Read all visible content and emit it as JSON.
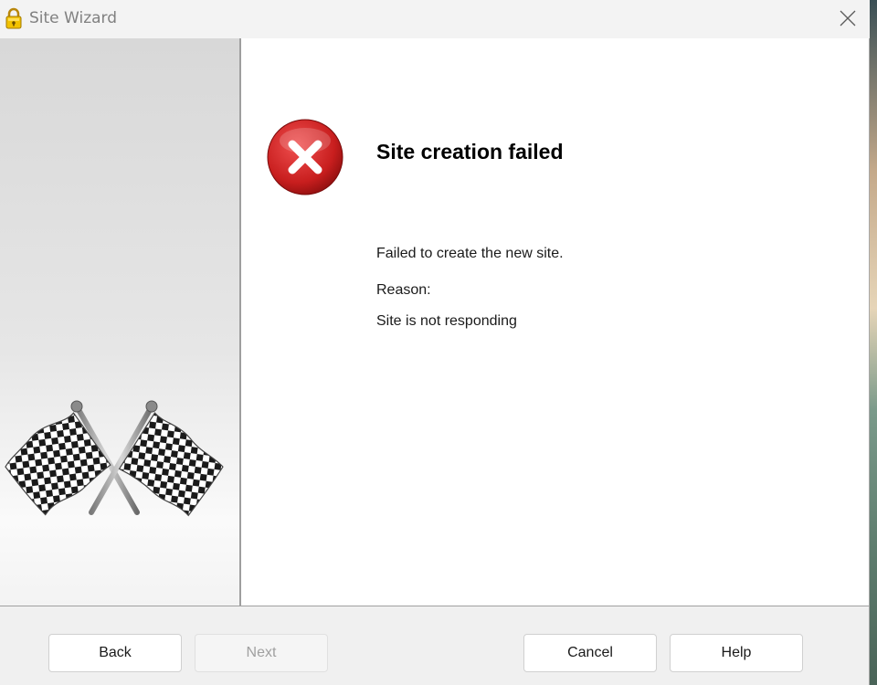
{
  "window": {
    "title": "Site Wizard",
    "app_icon": "padlock-icon",
    "close_icon": "close-icon"
  },
  "panel": {
    "illustration": "checkered-flags-icon"
  },
  "result": {
    "icon": "error-icon",
    "heading": "Site creation failed",
    "message": "Failed to create the new site.",
    "reason_label": "Reason:",
    "reason": "Site is not responding"
  },
  "buttons": {
    "back": "Back",
    "next": "Next",
    "cancel": "Cancel",
    "help": "Help"
  },
  "colors": {
    "error_red": "#d32a2a",
    "disabled_text": "#a0a0a0"
  }
}
